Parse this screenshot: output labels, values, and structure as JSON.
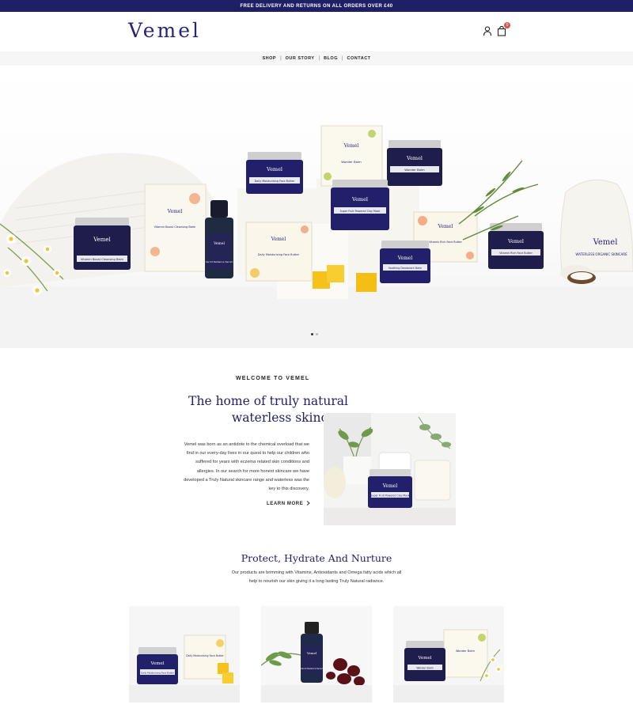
{
  "announcement": "FREE DELIVERY AND RETURNS ON ALL ORDERS OVER £40",
  "brand": {
    "name": "Vemel",
    "color": "#25237a"
  },
  "header": {
    "account_icon": "user-icon",
    "cart_icon": "shopping-bag-icon",
    "cart_count": "0"
  },
  "nav": {
    "items": [
      "SHOP",
      "OUR STORY",
      "BLOG",
      "CONTACT"
    ]
  },
  "hero": {
    "slide_count": 2,
    "active_slide": 1,
    "products": [
      {
        "label": "Vitamin Boost Cleansing Balm"
      },
      {
        "label": "Vitamin Boost Cleansing Balm"
      },
      {
        "label": "Carrot Radiance Serum"
      },
      {
        "label": "Daily Moisturising Face Butter"
      },
      {
        "label": "Daily Moisturising Face Butter"
      },
      {
        "label": "Wonder Balm"
      },
      {
        "label": "Wonder Balm"
      },
      {
        "label": "Super Fruit Powered Clay Mask"
      },
      {
        "label": "Vitamin Rich Face Butter"
      },
      {
        "label": "Vitamin Rich Face Butter"
      },
      {
        "label": "Soothing Deodorant Balm"
      }
    ],
    "pouch_brand": "Vemel",
    "pouch_text": "WATERLESS ORGANIC SKINCARE"
  },
  "welcome": {
    "eyebrow": "WELCOME TO VEMEL",
    "headline_line1": "The home of truly natural",
    "headline_line2": "waterless skincare",
    "body": "Vemel was born as an antidote to the chemical overload that we find in our every-day lives in our quest to help our children who suffered for years with eczema related skin conditions and allergies. In our search for more honest skincare we have developed a Truly Natural skincare range and waterless was the key to this discovery.",
    "cta": "LEARN MORE",
    "cta_icon": "chevron-right-icon",
    "photo_product": "Super Fruit Powered Clay Mask"
  },
  "section2": {
    "title": "Protect, Hydrate And Nurture",
    "text": "Our products are brimming with Vitamins, Antioxidants and Omega fatty acids which all help to nourish our skin giving it a long lasting Truly Natural radiance."
  },
  "products": [
    {
      "name": "Daily Moisturising Face Butter"
    },
    {
      "name": "Carrot Radiance Serum"
    },
    {
      "name": "Wonder Balm"
    }
  ],
  "colors": {
    "navy": "#1f1f66",
    "accent": "#d9534f"
  }
}
